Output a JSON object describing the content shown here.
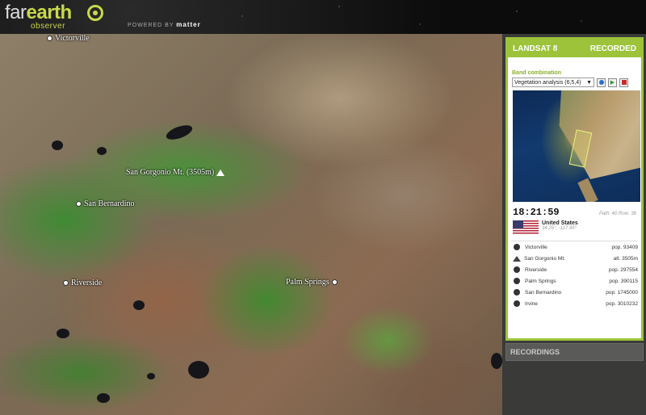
{
  "brand": {
    "name_pre": "far",
    "name_accent": "earth",
    "sub": "observer",
    "powered_by": "POWERED BY",
    "powered_company": "matter"
  },
  "map": {
    "labels": [
      {
        "text": "Victorville",
        "kind": "city"
      },
      {
        "text": "San Gorgonio Mt. (3505m)",
        "kind": "peak"
      },
      {
        "text": "San Bernardino",
        "kind": "city"
      },
      {
        "text": "Riverside",
        "kind": "city"
      },
      {
        "text": "Palm Springs",
        "kind": "city"
      }
    ]
  },
  "panel": {
    "satellite": "LANDSAT 8",
    "status": "RECORDED",
    "band_label": "Band combination",
    "band_value": "Vegetation analysis (6,5,4)",
    "time": "18:21:59",
    "path_row": "Path: 40 Row: 36",
    "country": "United States",
    "coords": "34.25°, -117.95°",
    "pois": [
      {
        "name": "Victorville",
        "value": "pop. 93409",
        "kind": "city"
      },
      {
        "name": "San Gorgonio Mt.",
        "value": "alt. 3505m",
        "kind": "peak"
      },
      {
        "name": "Riverside",
        "value": "pop. 297554",
        "kind": "city"
      },
      {
        "name": "Palm Springs",
        "value": "pop. 390115",
        "kind": "city"
      },
      {
        "name": "San Bernardino",
        "value": "pop. 1745000",
        "kind": "city"
      },
      {
        "name": "Irvine",
        "value": "pop. 3010232",
        "kind": "city"
      }
    ],
    "recordings": "RECORDINGS"
  },
  "colors": {
    "accent": "#9cc33a"
  }
}
